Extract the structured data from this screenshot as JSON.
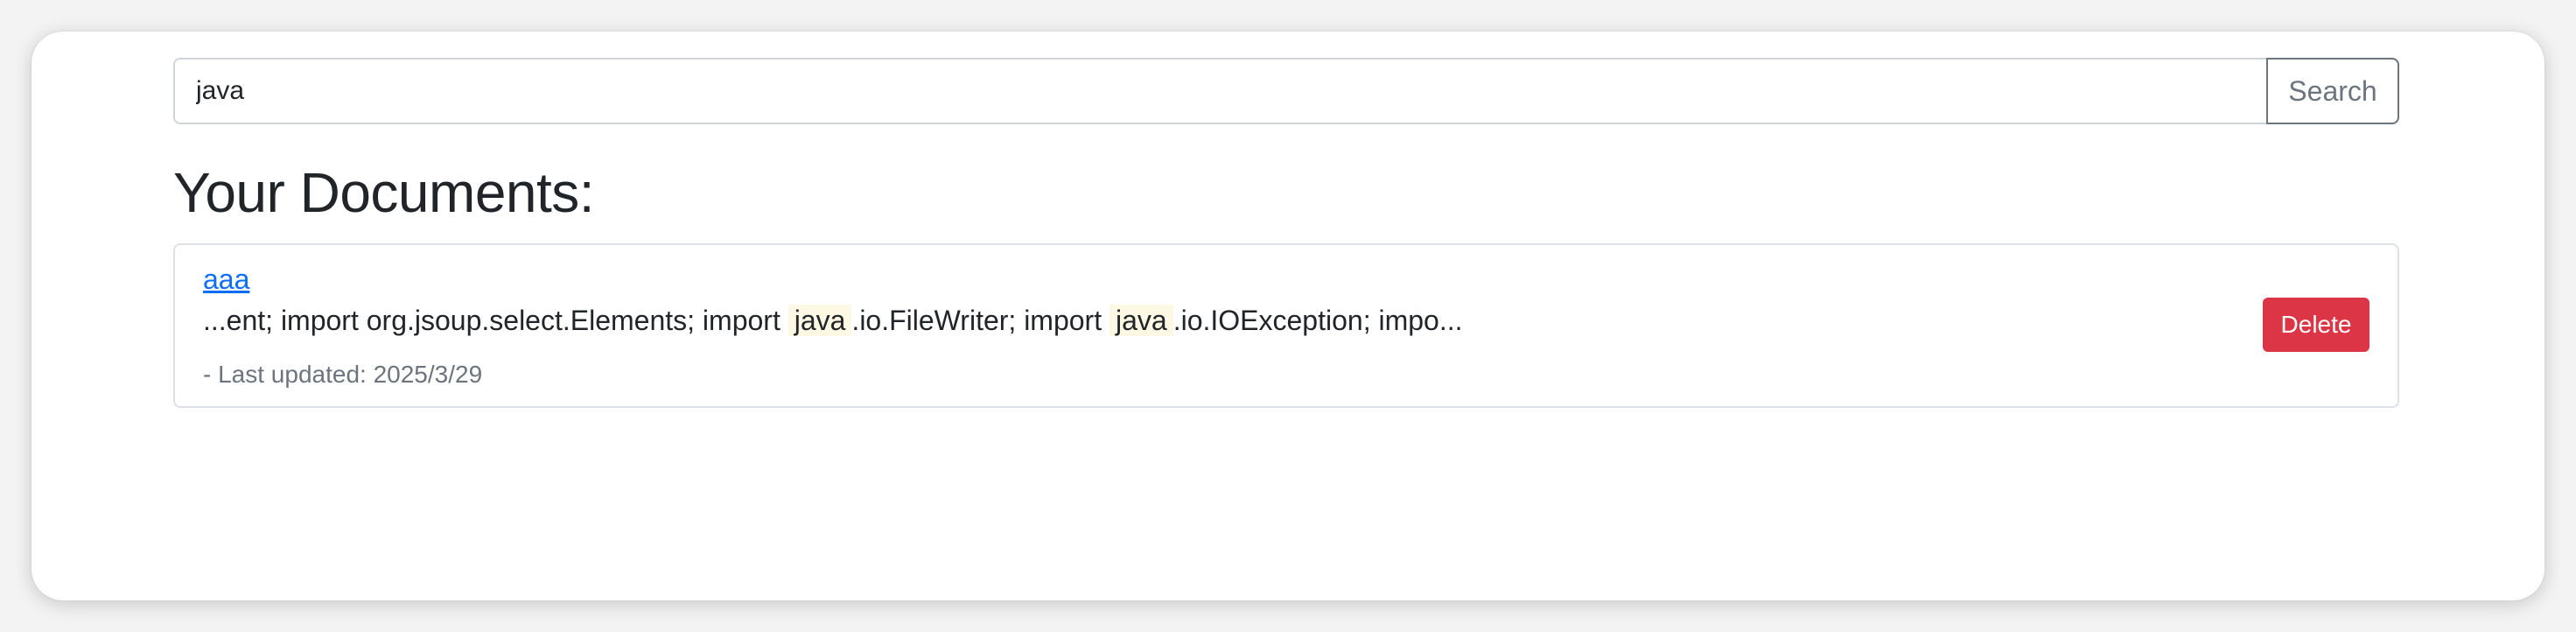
{
  "search": {
    "value": "java",
    "button_label": "Search"
  },
  "documents": {
    "heading": "Your Documents:",
    "items": [
      {
        "title": "aaa",
        "snippet": {
          "part1": "...ent; import org.jsoup.select.Elements; import ",
          "highlight1": "java",
          "part2": ".io.FileWriter; import ",
          "highlight2": "java",
          "part3": ".io.IOException; impo..."
        },
        "last_updated": "- Last updated: 2025/3/29",
        "delete_label": "Delete"
      }
    ]
  },
  "colors": {
    "link": "#0d6efd",
    "delete": "#dc3545",
    "highlight": "#fcf8e3",
    "muted": "#6c757d"
  }
}
